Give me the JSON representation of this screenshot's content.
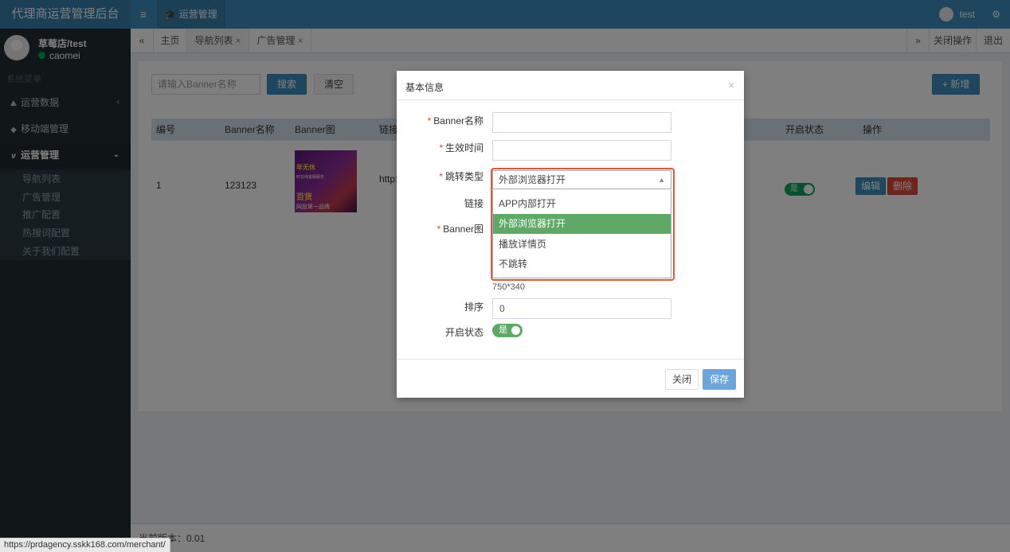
{
  "header": {
    "app_title": "代理商运营管理后台",
    "menu_toggle": "≡",
    "active_module": "运营管理",
    "user": "test"
  },
  "sidebar": {
    "user_name": "草莓店/test",
    "user_status": "caomei",
    "menu_header": "系统菜单",
    "items": [
      {
        "label": "运营数据",
        "icon": "chart-area-icon"
      },
      {
        "label": "移动端管理",
        "icon": "tag-icon"
      },
      {
        "label": "运营管理",
        "icon": "vimeo-icon"
      }
    ],
    "submenu": [
      "导航列表",
      "广告管理",
      "推广配置",
      "热搜词配置",
      "关于我们配置"
    ]
  },
  "tabs": {
    "prev": "«",
    "items": [
      {
        "label": "主页",
        "closable": false
      },
      {
        "label": "导航列表",
        "closable": true,
        "active": true
      },
      {
        "label": "广告管理",
        "closable": true
      }
    ],
    "close_symbol": "×",
    "next": "»",
    "close_ops": "关闭操作",
    "logout": "退出"
  },
  "toolbar": {
    "search_placeholder": "请输入Banner名称",
    "search_label": "搜索",
    "clear_label": "清空",
    "add_label": "+ 新增"
  },
  "table": {
    "columns": [
      "编号",
      "Banner名称",
      "Banner图",
      "链接",
      "开启状态",
      "操作"
    ],
    "rows": [
      {
        "id": "1",
        "name": "123123",
        "link": "http:",
        "status": "是",
        "edit": "编辑",
        "delete": "删除",
        "thumb_texts": [
          "年无休",
          "时在线客服服务",
          "百货",
          "网投第一品牌"
        ]
      }
    ]
  },
  "modal": {
    "title": "基本信息",
    "close_symbol": "×",
    "fields": {
      "banner_name_label": "Banner名称",
      "effective_time_label": "生效时间",
      "jump_type_label": "跳转类型",
      "link_label": "链接",
      "banner_img_label": "Banner图",
      "sort_label": "排序",
      "status_label": "开启状态"
    },
    "jump_type_value": "外部浏览器打开",
    "jump_options": [
      "APP内部打开",
      "外部浏览器打开",
      "播放详情页",
      "不跳转"
    ],
    "jump_selected_index": 1,
    "image_size_hint": "750*340",
    "sort_value": "0",
    "status_value": "是",
    "close_btn": "关闭",
    "save_btn": "保存"
  },
  "footer": {
    "version_text": "当前版本：0.01"
  },
  "status_url": "https://prdagency.sskk168.com/merchant/",
  "colors": {
    "header_blue": "#3c8dbc",
    "sidebar_dark": "#222d32",
    "selected_green": "#5ea965",
    "highlight_red": "#e8553a"
  }
}
